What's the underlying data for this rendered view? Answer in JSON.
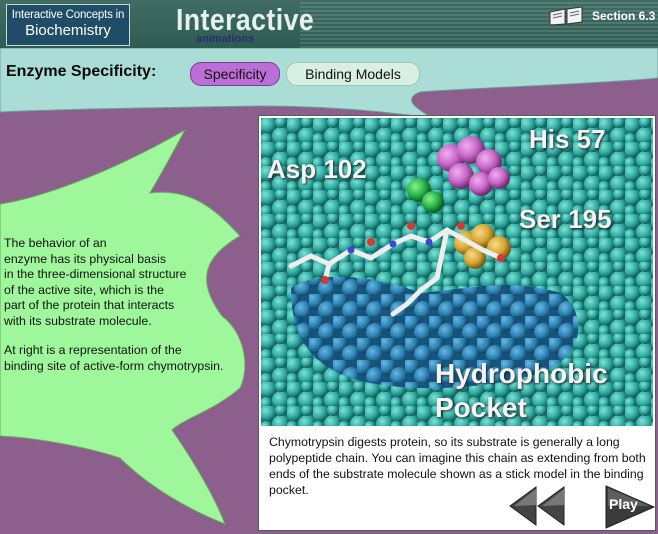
{
  "header": {
    "logo_line1": "Interactive Concepts in",
    "logo_line2": "Biochemistry",
    "brand_title": "Interactive",
    "brand_subtitle": "animations",
    "section_label": "Section 6.3",
    "section_icon": "open-book-icon"
  },
  "banner": {
    "page_title": "Enzyme Specificity:",
    "tabs": [
      {
        "label": "Specificity",
        "active": true
      },
      {
        "label": "Binding Models",
        "active": false
      }
    ]
  },
  "intro": {
    "paragraph1": "The behavior of an\nenzyme has its physical basis\nin the three-dimensional structure\nof the active site, which is the\npart of the protein that interacts\nwith its substrate molecule.",
    "paragraph2": "At right is a representation of the\nbinding site of active-form chymotrypsin."
  },
  "image_panel": {
    "labels": {
      "asp": "Asp 102",
      "his": "His 57",
      "ser": "Ser 195",
      "pocket_line1": "Hydrophobic",
      "pocket_line2": "Pocket"
    },
    "caption": "Chymotrypsin digests protein, so its substrate is generally a long polypeptide chain.  You can imagine this chain as extending from both ends of the substrate molecule shown as a stick model in the binding pocket."
  },
  "controls": {
    "rewind_icon": "rewind-icon",
    "play_label": "Play"
  },
  "colors": {
    "background": "#8c5f8c",
    "leaf": "#9ef79a",
    "banner": "#a9ddd6",
    "header": "#3f6d63",
    "tab_active": "#bb6fd6"
  }
}
